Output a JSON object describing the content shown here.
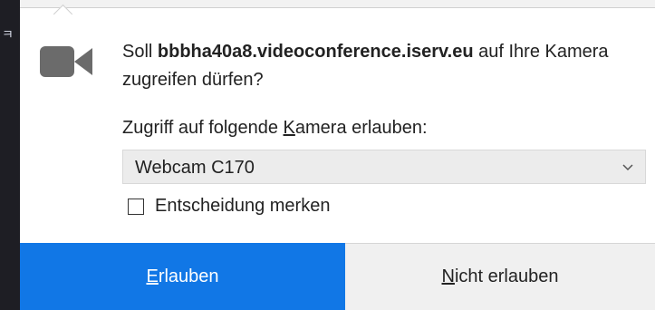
{
  "background": {
    "glyph": "ㅋ"
  },
  "dialog": {
    "message_prefix": "Soll ",
    "host": "bbbha40a8.videoconference.iserv.eu",
    "message_suffix": " auf Ihre Kamera zugreifen dürfen?",
    "camera_label_pre": "Zugriff auf folgende ",
    "camera_label_key": "K",
    "camera_label_post": "amera erlauben:",
    "camera_select": {
      "value": "Webcam C170"
    },
    "remember_label": "Entscheidung merken",
    "remember_checked": false,
    "allow_key": "E",
    "allow_rest": "rlauben",
    "deny_key": "N",
    "deny_rest": "icht erlauben"
  },
  "icons": {
    "camera": "video-camera-icon",
    "select_chevron": "chevron-down-icon"
  },
  "colors": {
    "allow_button": "#1177e6",
    "deny_button": "#f0f0f0",
    "camera_icon": "#6b6b6b",
    "select_bg": "#ececec"
  }
}
